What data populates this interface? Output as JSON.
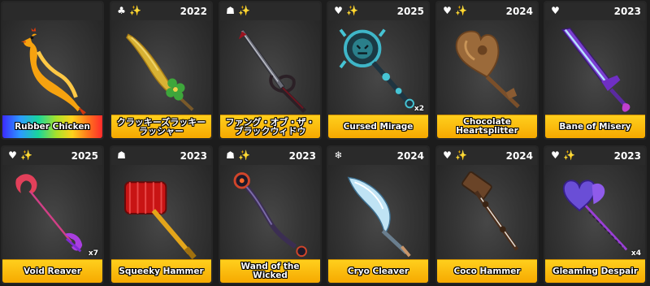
{
  "colors": {
    "name_bar": "#ffc400",
    "spark": "#f5d33c",
    "card_bg": "#262626"
  },
  "items": [
    {
      "name": "Rubber Chicken",
      "year": "",
      "icons": [],
      "qty": "",
      "art": "chicken",
      "rainbow": true
    },
    {
      "name": "クラッキーズラッキーラッシャー",
      "year": "2022",
      "icons": [
        "clover-icon",
        "sparkle-icon"
      ],
      "qty": "",
      "art": "clover-sword"
    },
    {
      "name": "ファング・オブ・ザ・ブラックウィドウ",
      "year": "",
      "icons": [
        "ghost-icon",
        "sparkle-icon"
      ],
      "qty": "",
      "art": "fang"
    },
    {
      "name": "Cursed Mirage",
      "year": "2025",
      "icons": [
        "heart-icon",
        "sparkle-icon"
      ],
      "qty": "x2",
      "art": "mirage"
    },
    {
      "name": "Chocolate Heartsplitter",
      "year": "2024",
      "icons": [
        "heart-icon",
        "sparkle-icon"
      ],
      "qty": "",
      "art": "choco"
    },
    {
      "name": "Bane of Misery",
      "year": "2023",
      "icons": [
        "heart-icon"
      ],
      "qty": "",
      "art": "bane"
    },
    {
      "name": "Void Reaver",
      "year": "2025",
      "icons": [
        "heart-icon",
        "sparkle-icon"
      ],
      "qty": "x7",
      "art": "reaver"
    },
    {
      "name": "Squeeky Hammer",
      "year": "2023",
      "icons": [
        "ghost-icon"
      ],
      "qty": "",
      "art": "hammer"
    },
    {
      "name": "Wand of the Wicked",
      "year": "2023",
      "icons": [
        "ghost-icon",
        "sparkle-icon"
      ],
      "qty": "",
      "art": "wand"
    },
    {
      "name": "Cryo Cleaver",
      "year": "2024",
      "icons": [
        "snowflake-icon"
      ],
      "qty": "",
      "art": "cryo"
    },
    {
      "name": "Coco Hammer",
      "year": "2024",
      "icons": [
        "heart-icon",
        "sparkle-icon"
      ],
      "qty": "",
      "art": "coco"
    },
    {
      "name": "Gleaming Despair",
      "year": "2023",
      "icons": [
        "heart-icon",
        "sparkle-icon"
      ],
      "qty": "x4",
      "art": "despair"
    }
  ]
}
